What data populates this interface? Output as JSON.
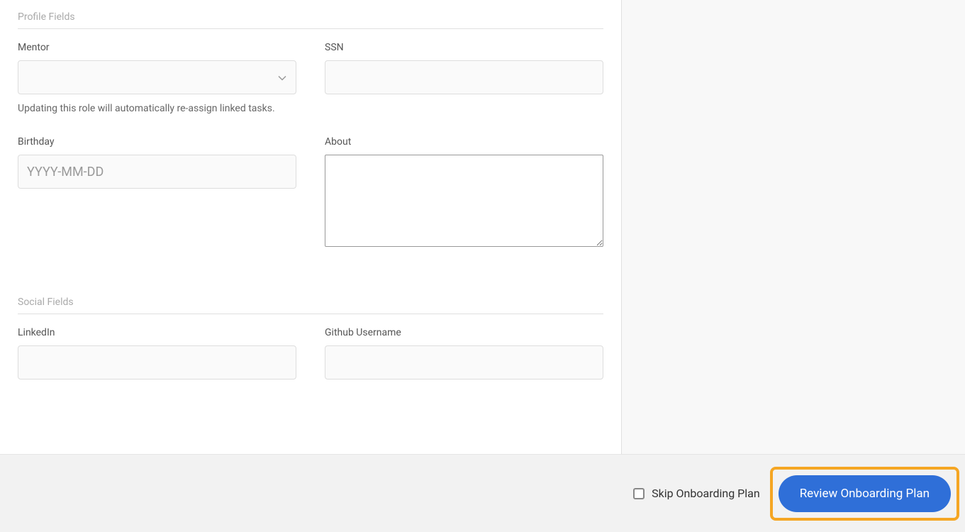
{
  "sections": {
    "profile": {
      "header": "Profile Fields",
      "fields": {
        "mentor": {
          "label": "Mentor",
          "help": "Updating this role will automatically re-assign linked tasks."
        },
        "ssn": {
          "label": "SSN"
        },
        "birthday": {
          "label": "Birthday",
          "placeholder": "YYYY-MM-DD"
        },
        "about": {
          "label": "About"
        }
      }
    },
    "social": {
      "header": "Social Fields",
      "fields": {
        "linkedin": {
          "label": "LinkedIn"
        },
        "github": {
          "label": "Github Username"
        }
      }
    }
  },
  "footer": {
    "skip_label": "Skip Onboarding Plan",
    "review_label": "Review Onboarding Plan"
  }
}
